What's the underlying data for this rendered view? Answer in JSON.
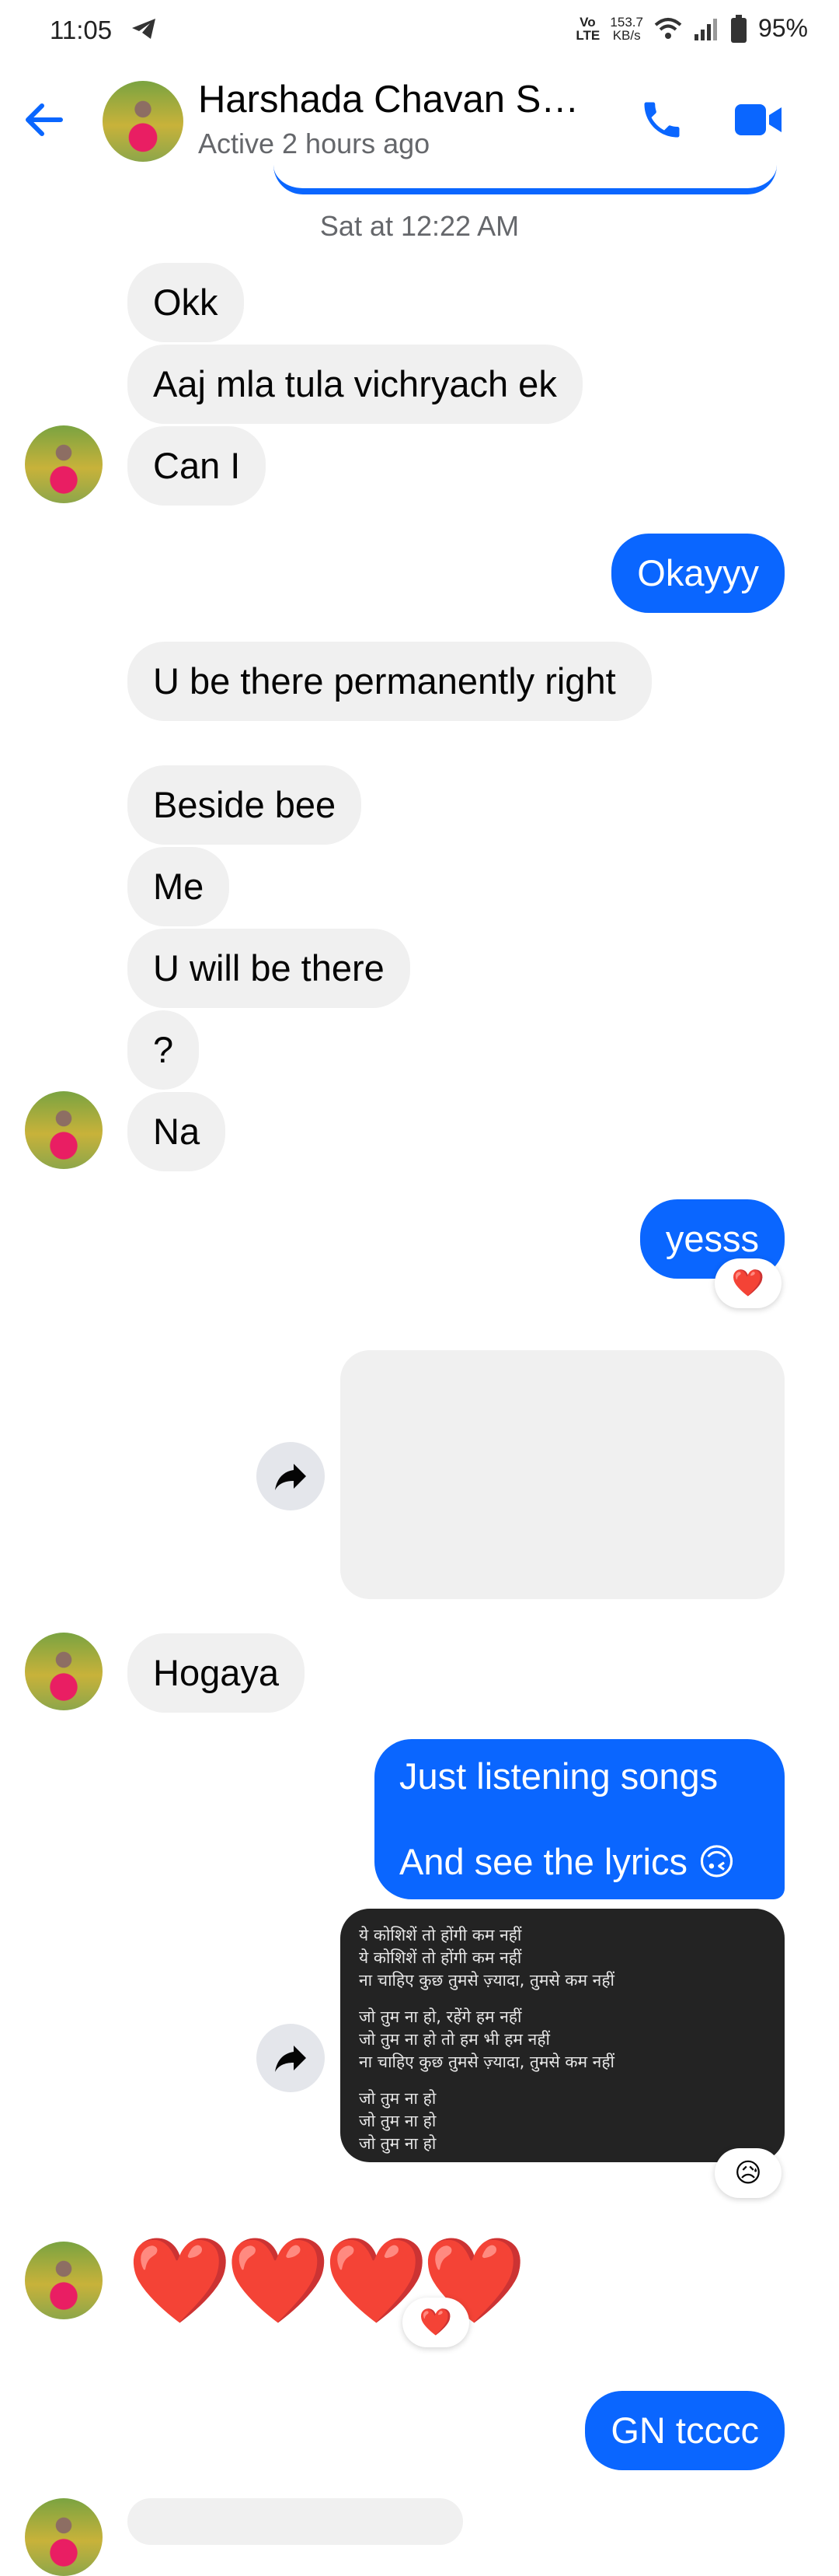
{
  "status_bar": {
    "time": "11:05",
    "telegram_icon": "telegram-icon",
    "lte_label": "Vo LTE",
    "speed_value": "153.7",
    "speed_unit": "KB/s",
    "battery": "95%"
  },
  "header": {
    "name": "Harshada Chavan S…",
    "status": "Active 2 hours ago"
  },
  "timestamp": "Sat at 12:22 AM",
  "messages": {
    "m1": "Okk",
    "m2": "Aaj mla tula vichryach ek",
    "m3": "Can I",
    "m4": "Okayyy",
    "m5": "U be there permanently right",
    "m6": "Beside bee",
    "m7": "Me",
    "m8": "U will be there",
    "m9": "?",
    "m10": "Na",
    "m11": "yesss",
    "m12": "Hogaya",
    "m13a": "Just listening songs",
    "m13b": "And see the lyrics 🙃",
    "m14": "GN tcccc"
  },
  "reactions": {
    "r1": "❤️",
    "r2": "😥",
    "r3": "❤️"
  },
  "hearts": "❤️❤️❤️❤️",
  "lyrics": {
    "l1": "ये कोशिशें तो होंगी कम नहीं",
    "l2": "ये कोशिशें तो होंगी कम नहीं",
    "l3": "ना चाहिए कुछ तुमसे ज़्यादा, तुमसे कम नहीं",
    "l4": "जो तुम ना हो, रहेंगे हम नहीं",
    "l5": "जो तुम ना हो तो हम भी हम नहीं",
    "l6": "ना चाहिए कुछ तुमसे ज़्यादा, तुमसे कम नहीं",
    "l7": "जो तुम ना हो",
    "l8": "जो तुम ना हो",
    "l9": "जो तुम ना हो"
  },
  "colors": {
    "accent": "#0a66ff",
    "incoming_bubble": "#f0f0f0",
    "secondary_text": "#65676b"
  }
}
